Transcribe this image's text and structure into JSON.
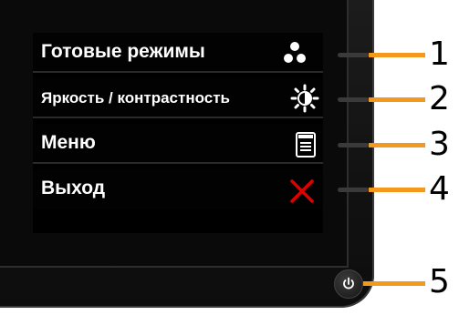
{
  "menu": {
    "items": [
      {
        "label": "Готовые режимы",
        "icon": "preset-modes-icon"
      },
      {
        "label": "Яркость / контрастность",
        "icon": "brightness-contrast-icon"
      },
      {
        "label": "Меню",
        "icon": "menu-icon"
      },
      {
        "label": "Выход",
        "icon": "exit-icon"
      }
    ]
  },
  "callouts": [
    "1",
    "2",
    "3",
    "4",
    "5"
  ],
  "colors": {
    "accent": "#f39a1e",
    "exit": "#e00000",
    "text": "#ffffff"
  }
}
